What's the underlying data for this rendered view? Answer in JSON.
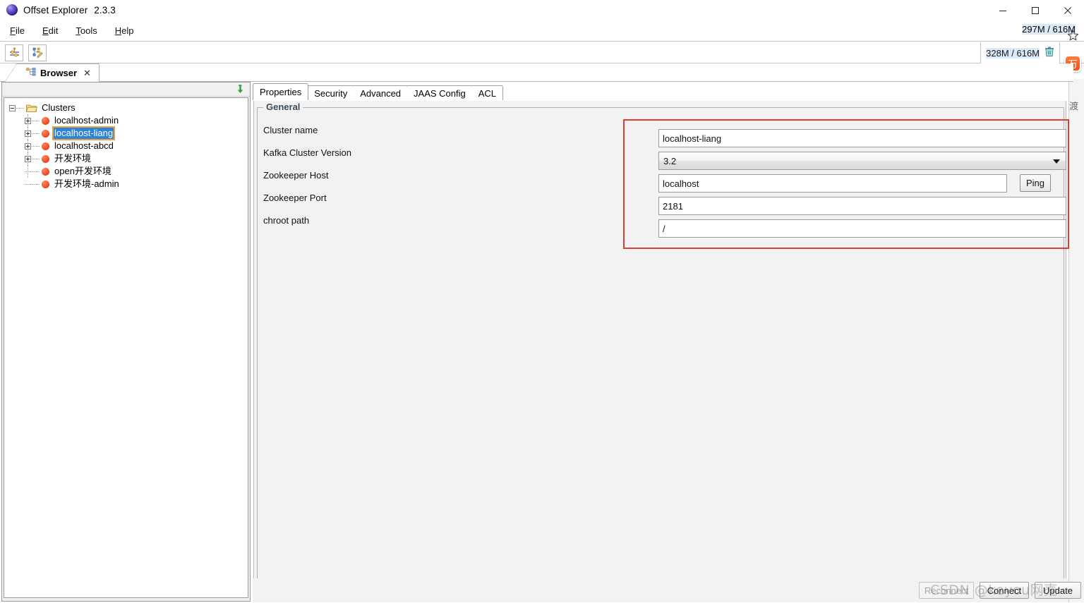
{
  "window": {
    "title": "Offset Explorer",
    "version": "2.3.3",
    "app_icon": "sphere-icon",
    "controls": {
      "minimize": "minimize-icon",
      "maximize": "maximize-icon",
      "close": "close-icon"
    }
  },
  "menubar": {
    "items": [
      {
        "label": "File",
        "mnemonic": "F"
      },
      {
        "label": "Edit",
        "mnemonic": "E"
      },
      {
        "label": "Tools",
        "mnemonic": "T"
      },
      {
        "label": "Help",
        "mnemonic": "H"
      }
    ],
    "memory": "297M / 616M"
  },
  "toolbar": {
    "buttons": [
      {
        "name": "add-cluster-button",
        "icon": "connection-settings-icon"
      },
      {
        "name": "edit-cluster-button",
        "icon": "tree-edit-icon"
      }
    ],
    "memory": "328M / 616M",
    "gc_icon": "trash-icon"
  },
  "edge": {
    "star_icon": "star-icon",
    "badge_glyph": "万",
    "strip_text": "渡"
  },
  "editor_tabs": {
    "active": "Browser",
    "tabs": [
      {
        "label": "Browser",
        "icon": "tree-browser-icon",
        "close": "✕"
      }
    ]
  },
  "tree_panel": {
    "collapse_all_icon": "collapse-all-icon",
    "root": {
      "label": "Clusters",
      "icon": "folder-open-icon",
      "expander": "minus"
    },
    "items": [
      {
        "label": "localhost-admin",
        "icon": "cluster-dot-icon",
        "expander": "plus",
        "selected": false
      },
      {
        "label": "localhost-liang",
        "icon": "cluster-dot-icon",
        "expander": "plus",
        "selected": true
      },
      {
        "label": "localhost-abcd",
        "icon": "cluster-dot-icon",
        "expander": "plus",
        "selected": false
      },
      {
        "label": "开发环境",
        "icon": "cluster-dot-icon",
        "expander": "plus",
        "selected": false
      },
      {
        "label": "open开发环境",
        "icon": "cluster-dot-icon",
        "expander": "none",
        "selected": false
      },
      {
        "label": "开发环境-admin",
        "icon": "cluster-dot-icon",
        "expander": "none",
        "selected": false
      }
    ]
  },
  "main": {
    "tabs": [
      {
        "label": "Properties",
        "active": true
      },
      {
        "label": "Security",
        "active": false
      },
      {
        "label": "Advanced",
        "active": false
      },
      {
        "label": "JAAS Config",
        "active": false
      },
      {
        "label": "ACL",
        "active": false
      }
    ],
    "group_title": "General",
    "fields": [
      {
        "label": "Cluster name",
        "type": "text",
        "value": "localhost-liang"
      },
      {
        "label": "Kafka Cluster Version",
        "type": "combo",
        "value": "3.2"
      },
      {
        "label": "Zookeeper Host",
        "type": "text",
        "value": "localhost",
        "button": "Ping"
      },
      {
        "label": "Zookeeper Port",
        "type": "text",
        "value": "2181"
      },
      {
        "label": "chroot path",
        "type": "text",
        "value": "/"
      }
    ]
  },
  "footer": {
    "buttons": [
      {
        "label": "Reconnect",
        "enabled": false
      },
      {
        "label": "Connect",
        "enabled": true
      },
      {
        "label": "Update",
        "enabled": true
      }
    ],
    "watermark": "CSDN @keyou网壳"
  },
  "colors": {
    "selection_blue": "#2f83d8",
    "selection_border": "#e8a33d",
    "annotation_red": "#e03b30",
    "cluster_dot": "#f4512a",
    "group_label": "#3d4a58",
    "panel_bg": "#f2f2f2"
  }
}
